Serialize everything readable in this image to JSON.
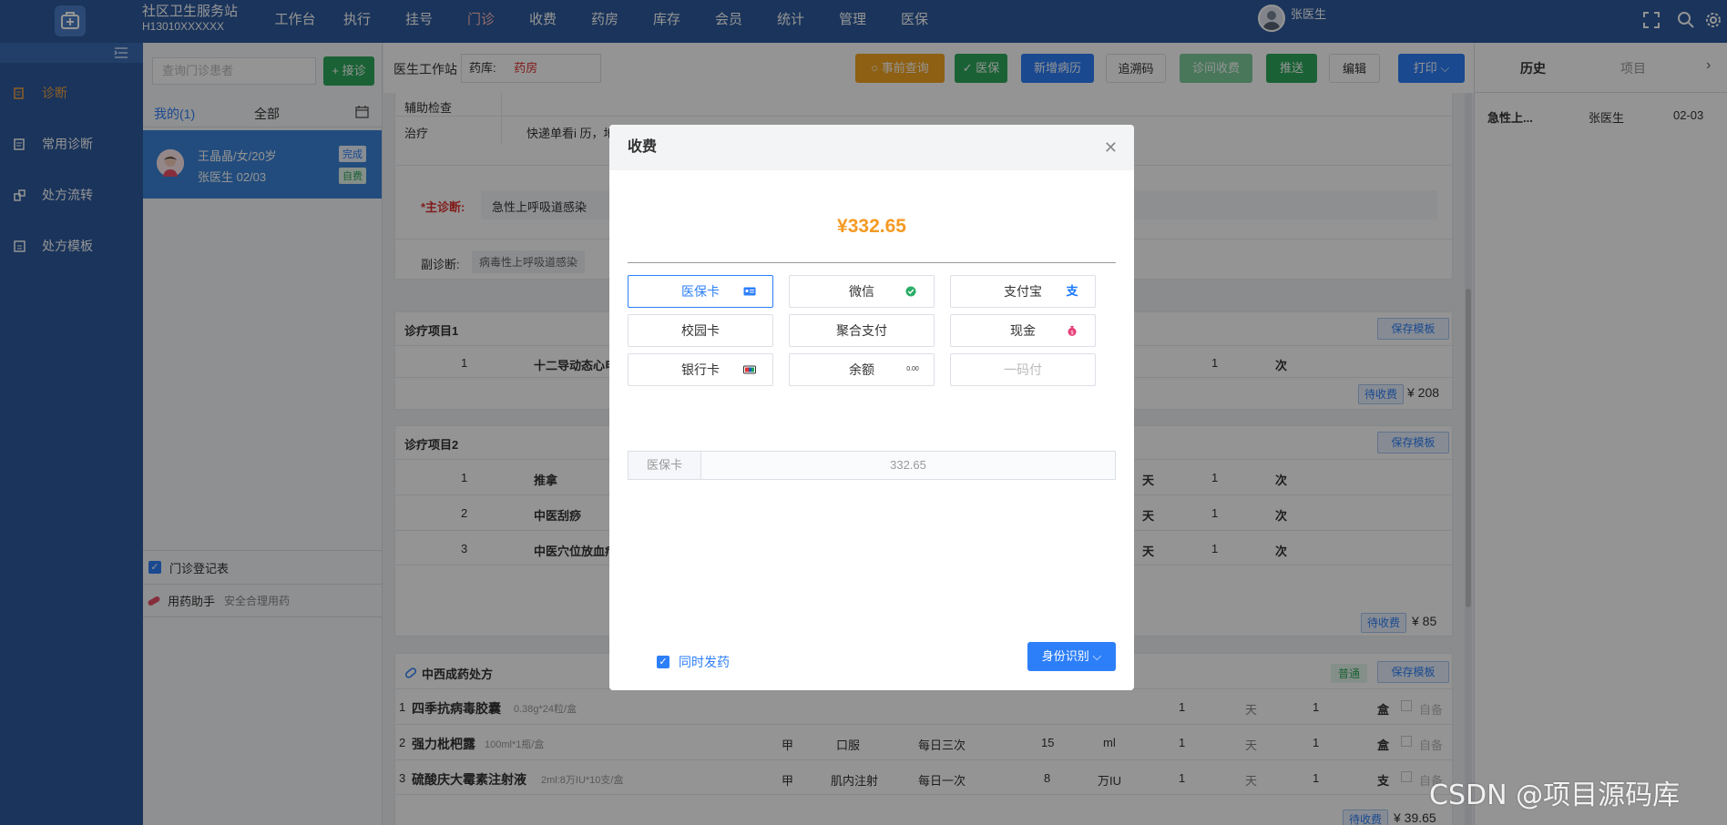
{
  "header": {
    "org_name": "社区卫生服务站",
    "org_code": "H13010XXXXXX",
    "nav": [
      "工作台",
      "执行",
      "挂号",
      "门诊",
      "收费",
      "药房",
      "库存",
      "会员",
      "统计",
      "管理",
      "医保"
    ],
    "active_nav": "门诊",
    "user_name": "张医生"
  },
  "sidebar": {
    "items": [
      {
        "label": "诊断",
        "icon": "diagnosis-icon"
      },
      {
        "label": "常用诊断",
        "icon": "common-diagnosis-icon"
      },
      {
        "label": "处方流转",
        "icon": "prescription-flow-icon"
      },
      {
        "label": "处方模板",
        "icon": "prescription-template-icon"
      }
    ]
  },
  "patients_panel": {
    "search_placeholder": "查询门诊患者",
    "receive_button": "+ 接诊",
    "tab_mine": "我的(1)",
    "tab_all": "全部",
    "patient": {
      "name": "王晶晶/女/20岁",
      "doctor_date": "张医生  02/03",
      "status": "完成",
      "pay_type": "自费"
    },
    "register_label": "门诊登记表",
    "assistant_label": "用药助手",
    "assistant_sub": "安全合理用药"
  },
  "toolbar": {
    "station": "医生工作站",
    "pharmacy_label": "药库:",
    "pharmacy_value": "药房",
    "buttons": [
      "事前查询",
      "医保",
      "新增病历",
      "追溯码",
      "诊间收费",
      "推送",
      "编辑",
      "打印"
    ]
  },
  "record": {
    "aux_label": "辅助检查",
    "treatment_label": "治疗",
    "treatment_value": "快递单看i  历，地",
    "main_dx_label": "*主诊断:",
    "main_dx_value": "急性上呼吸道感染",
    "sub_dx_label": "副诊断:",
    "sub_dx_value": "病毒性上呼吸道感染"
  },
  "items1": {
    "title": "诊疗项目1",
    "save_template": "保存模板",
    "rows": [
      {
        "no": "1",
        "name": "十二导动态心电",
        "qty": "1",
        "unit": "次"
      }
    ],
    "status": "待收费",
    "total": "¥ 208"
  },
  "items2": {
    "title": "诊疗项目2",
    "save_template": "保存模板",
    "rows": [
      {
        "no": "1",
        "name": "推拿",
        "days": "天",
        "qty": "1",
        "unit": "次"
      },
      {
        "no": "2",
        "name": "中医刮痧",
        "days": "天",
        "qty": "1",
        "unit": "次"
      },
      {
        "no": "3",
        "name": "中医穴位放血疗",
        "days": "天",
        "qty": "1",
        "unit": "次"
      }
    ],
    "status": "待收费",
    "total": "¥ 85"
  },
  "prescription": {
    "title": "中西成药处方",
    "tag": "普通",
    "save_template": "保存模板",
    "rows": [
      {
        "no": "1",
        "name": "四季抗病毒胶囊",
        "spec": "0.38g*24粒/盒",
        "cls": "",
        "route": "",
        "freq": "",
        "dose": "",
        "dose_unit": "",
        "days": "1",
        "days_unit": "天",
        "qty": "1",
        "unit": "盒",
        "self": "自备"
      },
      {
        "no": "2",
        "name": "强力枇杷露",
        "spec": "100ml*1瓶/盒",
        "cls": "甲",
        "route": "口服",
        "freq": "每日三次",
        "dose": "15",
        "dose_unit": "ml",
        "days": "1",
        "days_unit": "天",
        "qty": "1",
        "unit": "盒",
        "self": "自备"
      },
      {
        "no": "3",
        "name": "硫酸庆大霉素注射液",
        "spec": "2ml:8万IU*10支/盒",
        "cls": "甲",
        "route": "肌内注射",
        "freq": "每日一次",
        "dose": "8",
        "dose_unit": "万IU",
        "days": "1",
        "days_unit": "天",
        "qty": "1",
        "unit": "支",
        "self": "自备"
      }
    ],
    "status": "待收费",
    "total": "¥ 39.65"
  },
  "history": {
    "tab_history": "历史",
    "tab_items": "项目",
    "row": {
      "dx": "急性上...",
      "doctor": "张医生",
      "date": "02-03"
    }
  },
  "modal": {
    "title": "收费",
    "amount": "¥332.65",
    "methods": [
      {
        "label": "医保卡",
        "icon": "id-card-icon",
        "state": "selected"
      },
      {
        "label": "微信",
        "icon": "wechat-icon",
        "state": "normal"
      },
      {
        "label": "支付宝",
        "icon": "alipay-icon",
        "state": "normal"
      },
      {
        "label": "校园卡",
        "icon": "",
        "state": "normal"
      },
      {
        "label": "聚合支付",
        "icon": "",
        "state": "normal"
      },
      {
        "label": "现金",
        "icon": "money-bag-icon",
        "state": "normal"
      },
      {
        "label": "银行卡",
        "icon": "bank-card-icon",
        "state": "normal"
      },
      {
        "label": "余额",
        "icon": "balance-icon",
        "state": "normal"
      },
      {
        "label": "一码付",
        "icon": "",
        "state": "disabled"
      }
    ],
    "balance_icon_text": "0.00",
    "summary_label": "医保卡",
    "summary_value": "332.65",
    "dispense_label": "同时发药",
    "id_button": "身份识别"
  },
  "watermark": "CSDN @项目源码库",
  "colors": {
    "primary": "#2d5a9e",
    "accent": "#2d7ff9",
    "amount": "#f59a23",
    "green": "#2eaa5c"
  }
}
